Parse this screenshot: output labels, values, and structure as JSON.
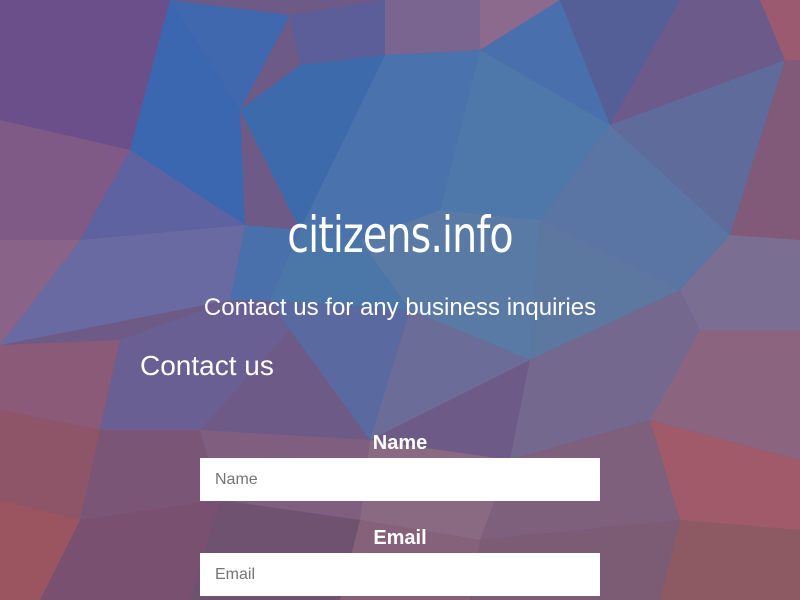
{
  "site": {
    "title": "citizens.info",
    "tagline": "Contact us for any business inquiries"
  },
  "contact_form": {
    "heading": "Contact us",
    "fields": [
      {
        "label": "Name",
        "placeholder": "Name",
        "value": ""
      },
      {
        "label": "Email",
        "placeholder": "Email",
        "value": ""
      }
    ]
  },
  "colors": {
    "text": "#ffffff",
    "input_background": "#ffffff",
    "background_primary": "#4a6ea8",
    "background_secondary": "#8a5a72"
  }
}
